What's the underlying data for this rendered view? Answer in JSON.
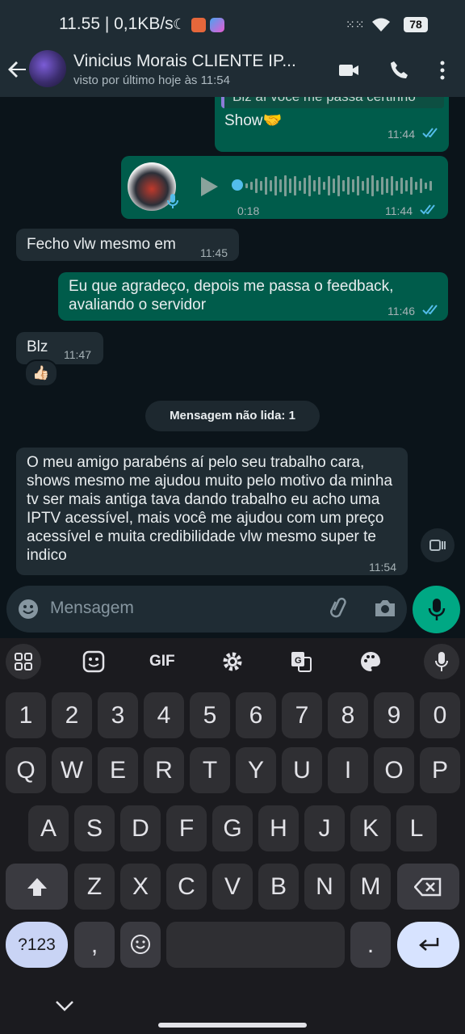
{
  "status_bar": {
    "time_speed": "11.55 | 0,1KB/s",
    "battery": "78"
  },
  "header": {
    "contact_name": "Vinicius Morais CLIENTE IP...",
    "last_seen": "visto por último hoje às 11:54"
  },
  "messages": [
    {
      "dir": "out",
      "text": "Blz aí você me passa certinho",
      "time": ""
    },
    {
      "dir": "out",
      "text": "Show🤝",
      "time": "11:44"
    },
    {
      "dir": "out",
      "type": "audio",
      "duration": "0:18",
      "time": "11:44"
    },
    {
      "dir": "in",
      "text": "Fecho vlw mesmo em",
      "time": "11:45"
    },
    {
      "dir": "out",
      "text": "Eu que agradeço, depois me passa o feedback, avaliando o servidor",
      "time": "11:46"
    },
    {
      "dir": "in",
      "text": "Blz",
      "time": "11:47",
      "reaction": "👍🏻"
    },
    {
      "dir": "in",
      "text": "O meu amigo parabéns aí pelo seu trabalho cara, shows mesmo me ajudou muito pelo motivo da minha tv ser mais antiga tava dando trabalho eu acho uma IPTV acessível, mais você me ajudou com um preço acessível e muita credibilidade vlw mesmo super te indico",
      "time": "11:54"
    }
  ],
  "unread_label": "Mensagem não lida: 1",
  "composer": {
    "placeholder": "Mensagem"
  },
  "keyboard": {
    "toolbar": [
      "apps-icon",
      "sticker-icon",
      "GIF",
      "settings-icon",
      "translate-icon",
      "palette-icon",
      "mic-icon"
    ],
    "row_numbers": [
      "1",
      "2",
      "3",
      "4",
      "5",
      "6",
      "7",
      "8",
      "9",
      "0"
    ],
    "row1": [
      "Q",
      "W",
      "E",
      "R",
      "T",
      "Y",
      "U",
      "I",
      "O",
      "P"
    ],
    "row2": [
      "A",
      "S",
      "D",
      "F",
      "G",
      "H",
      "J",
      "K",
      "L"
    ],
    "row3": [
      "Z",
      "X",
      "C",
      "V",
      "B",
      "N",
      "M"
    ],
    "symbols_key": "?123",
    "comma": ",",
    "period": "."
  },
  "colors": {
    "header_bg": "#1f2c34",
    "chat_bg": "#0b141a",
    "incoming_bubble": "#202c33",
    "outgoing_bubble": "#005c4b",
    "accent": "#00a884",
    "tick_blue": "#53bdeb"
  }
}
